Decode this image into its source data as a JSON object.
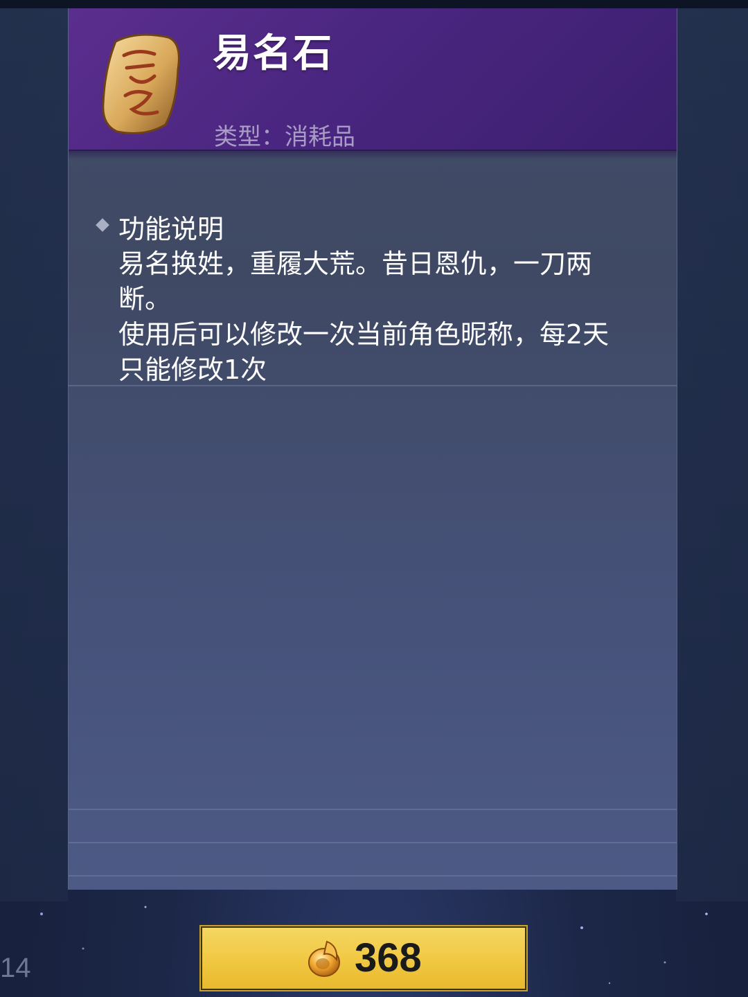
{
  "item": {
    "name": "易名石",
    "type_label": "类型：消耗品",
    "icon": "name-stone-icon"
  },
  "description": {
    "title": "功能说明",
    "lines": [
      "易名换姓，重履大荒。昔日恩仇，一刀两断。",
      "使用后可以修改一次当前角色昵称，每2天只能修改1次"
    ]
  },
  "purchase": {
    "price": "368",
    "currency_icon": "gold-ingot-icon"
  },
  "corner_label": "14",
  "colors": {
    "header_purple": "#4a2680",
    "card_body": "#424d68",
    "button_gold": "#f1c944"
  }
}
